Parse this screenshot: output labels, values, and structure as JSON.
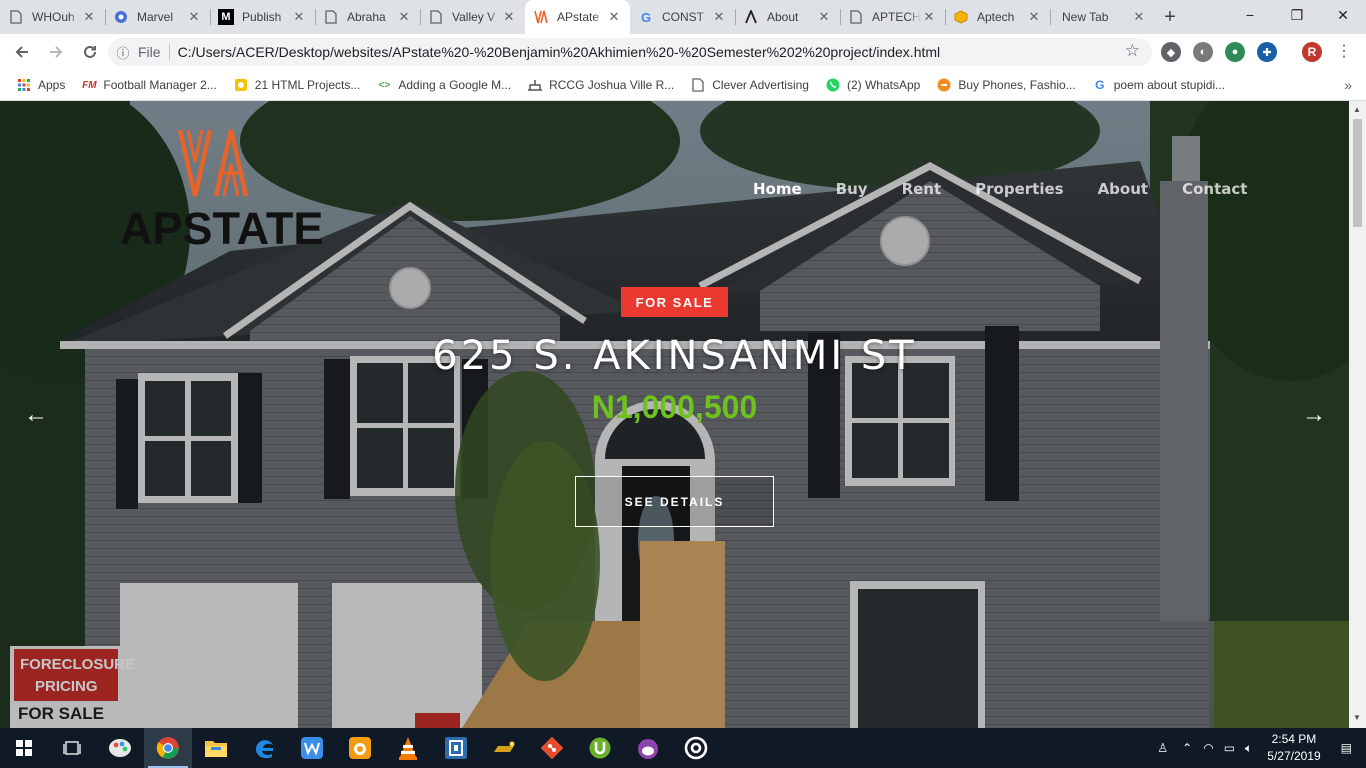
{
  "browser": {
    "tabs": [
      {
        "title": "WHOuh",
        "icon": "page-icon"
      },
      {
        "title": "Marvel",
        "icon": "globe-icon"
      },
      {
        "title": "Publish",
        "icon": "medium-icon"
      },
      {
        "title": "Abraha",
        "icon": "page-icon"
      },
      {
        "title": "Valley V",
        "icon": "page-icon"
      },
      {
        "title": "APstate",
        "icon": "apstate-icon",
        "active": true
      },
      {
        "title": "CONST",
        "icon": "google-icon"
      },
      {
        "title": "About",
        "icon": "lambda-icon"
      },
      {
        "title": "APTECH",
        "icon": "page-icon"
      },
      {
        "title": "Aptech",
        "icon": "cube-icon"
      },
      {
        "title": "New Tab",
        "icon": "none"
      }
    ],
    "new_tab_symbol": "+",
    "window_controls": {
      "minimize": "−",
      "maximize": "❐",
      "close": "✕"
    },
    "address": {
      "scheme_label": "File",
      "url": "C:/Users/ACER/Desktop/websites/APstate%20-%20Benjamin%20Akhimien%20-%20Semester%202%20project/index.html"
    },
    "profile_initial": "R",
    "bookmarks": [
      {
        "label": "Apps",
        "icon": "apps-grid-icon"
      },
      {
        "label": "Football Manager 2...",
        "icon": "fm-icon"
      },
      {
        "label": "21 HTML Projects...",
        "icon": "yellow-diamond-icon"
      },
      {
        "label": "Adding a Google M...",
        "icon": "code-icon"
      },
      {
        "label": "RCCG Joshua Ville R...",
        "icon": "church-icon"
      },
      {
        "label": "Clever Advertising",
        "icon": "page-icon"
      },
      {
        "label": "(2) WhatsApp",
        "icon": "whatsapp-icon"
      },
      {
        "label": "Buy Phones, Fashio...",
        "icon": "jumia-icon"
      },
      {
        "label": "poem about stupidi...",
        "icon": "google-icon"
      }
    ],
    "bookmarks_overflow": "»"
  },
  "site": {
    "logo_text": "APSTATE",
    "nav": [
      {
        "label": "Home",
        "current": true
      },
      {
        "label": "Buy"
      },
      {
        "label": "Rent"
      },
      {
        "label": "Properties"
      },
      {
        "label": "About"
      },
      {
        "label": "Contact"
      }
    ],
    "hero": {
      "badge": "FOR SALE",
      "title": "625 S. AKINSANMI ST",
      "price": "N1,000,500",
      "cta_label": "SEE DETAILS",
      "prev_symbol": "←",
      "next_symbol": "→"
    },
    "colors": {
      "badge": "#ea3a2f",
      "price": "#6fc21d",
      "logo_accent": "#e8632a"
    }
  },
  "taskbar": {
    "apps": [
      {
        "name": "start-button",
        "icon": "windows-icon"
      },
      {
        "name": "task-view",
        "icon": "task-view-icon"
      },
      {
        "name": "paint",
        "icon": "paint-icon"
      },
      {
        "name": "chrome",
        "icon": "chrome-icon",
        "running": true,
        "active": true
      },
      {
        "name": "file-explorer",
        "icon": "folder-icon"
      },
      {
        "name": "edge",
        "icon": "edge-icon"
      },
      {
        "name": "wps-writer",
        "icon": "wps-icon"
      },
      {
        "name": "uc-browser",
        "icon": "uc-icon"
      },
      {
        "name": "vlc",
        "icon": "vlc-icon"
      },
      {
        "name": "app-blue",
        "icon": "square-app-icon"
      },
      {
        "name": "lamp-app",
        "icon": "lamp-icon"
      },
      {
        "name": "git",
        "icon": "git-icon"
      },
      {
        "name": "utorrent",
        "icon": "utorrent-icon"
      },
      {
        "name": "cat-app",
        "icon": "cat-icon"
      },
      {
        "name": "target-app",
        "icon": "target-icon"
      }
    ],
    "clock_time": "2:54 PM",
    "clock_date": "5/27/2019"
  }
}
